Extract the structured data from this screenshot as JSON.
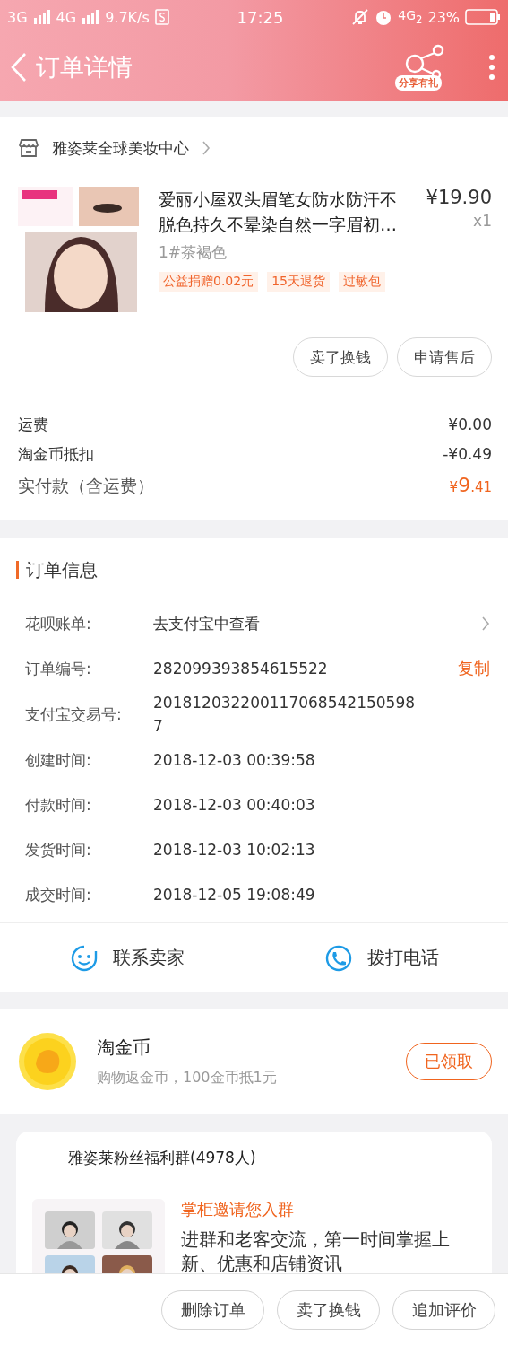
{
  "status_bar": {
    "networks": [
      "3G",
      "4G"
    ],
    "speed": "9.7K/s",
    "time": "17:25",
    "network": "4G$_{2}$",
    "battery": "23%"
  },
  "header": {
    "title": "订单详情",
    "share_label": "分享有礼"
  },
  "shop": {
    "name": "雅姿莱全球美妆中心"
  },
  "product": {
    "image": {
      "kind": "picture"
    },
    "title": "爱丽小屋双头眉笔女防水防汗不脱色持久不晕染自然一字眉初…",
    "price": "¥19.90",
    "quantity": "x1",
    "variant": "1#茶褐色",
    "tags": [
      "公益捐赠0.02元",
      "15天退货",
      "过敏包"
    ]
  },
  "item_actions": [
    "卖了换钱",
    "申请售后"
  ],
  "fees": [
    {
      "kind": "plain",
      "label": "运费",
      "value": "¥0.00"
    },
    {
      "kind": "plain",
      "label": "淘金币抵扣",
      "value": "-¥0.49"
    },
    {
      "kind": "total",
      "label": "实付款（含运费）",
      "value": "¥9.41"
    }
  ],
  "order_info": {
    "title": "订单信息",
    "rows": [
      {
        "kind": "link",
        "label": "花呗账单:",
        "value": "去支付宝中查看"
      },
      {
        "kind": "copy",
        "label": "订单编号:",
        "value": "282099393854615522",
        "action": "复制"
      },
      {
        "kind": "plain",
        "label": "支付宝交易号:",
        "value": "2018120322001170685421505987"
      },
      {
        "kind": "plain",
        "label": "创建时间:",
        "value": "2018-12-03 00:39:58"
      },
      {
        "kind": "plain",
        "label": "付款时间:",
        "value": "2018-12-03 00:40:03"
      },
      {
        "kind": "plain",
        "label": "发货时间:",
        "value": "2018-12-03 10:02:13"
      },
      {
        "kind": "plain",
        "label": "成交时间:",
        "value": "2018-12-05 19:08:49"
      }
    ]
  },
  "contact": [
    {
      "kind": "chat",
      "label": "联系卖家"
    },
    {
      "kind": "phone",
      "label": "拨打电话"
    }
  ],
  "coin": {
    "title": "淘金币",
    "subtitle": "购物返金币，100金币抵1元",
    "button": "已领取"
  },
  "group": {
    "name": "雅姿莱粉丝福利群(4978人)",
    "avatars": [
      {
        "kind": "picture"
      },
      {
        "kind": "picture"
      },
      {
        "kind": "picture"
      },
      {
        "kind": "picture"
      }
    ],
    "invite_title": "掌柜邀请您入群",
    "invite_text": "进群和老客交流，第一时间掌握上新、优惠和店铺资讯"
  },
  "bottom_actions": [
    "删除订单",
    "卖了换钱",
    "追加评价"
  ]
}
